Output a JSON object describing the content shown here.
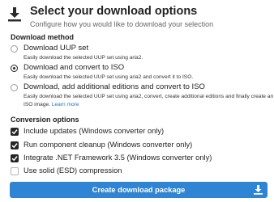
{
  "header": {
    "title": "Select your download options",
    "subtitle": "Configure how you would like to download your selection",
    "icon": "download-icon"
  },
  "download_method": {
    "heading": "Download method",
    "options": [
      {
        "label": "Download UUP set",
        "description": "Easily download the selected UUP set using aria2.",
        "selected": false
      },
      {
        "label": "Download and convert to ISO",
        "description": "Easily download the selected UUP set using aria2 and convert it to ISO.",
        "selected": true
      },
      {
        "label": "Download, add additional editions and convert to ISO",
        "description": "Easily download the selected UUP set using aria2, convert, create additional editions and finally create an ISO image.",
        "link": "Learn more",
        "selected": false
      }
    ]
  },
  "conversion_options": {
    "heading": "Conversion options",
    "items": [
      {
        "label": "Include updates (Windows converter only)",
        "checked": true
      },
      {
        "label": "Run component cleanup (Windows converter only)",
        "checked": true
      },
      {
        "label": "Integrate .NET Framework 3.5 (Windows converter only)",
        "checked": true
      },
      {
        "label": "Use solid (ESD) compression",
        "checked": false
      }
    ]
  },
  "create_button": {
    "label": "Create download package",
    "icon": "download-icon",
    "color": "#2f84d3"
  }
}
